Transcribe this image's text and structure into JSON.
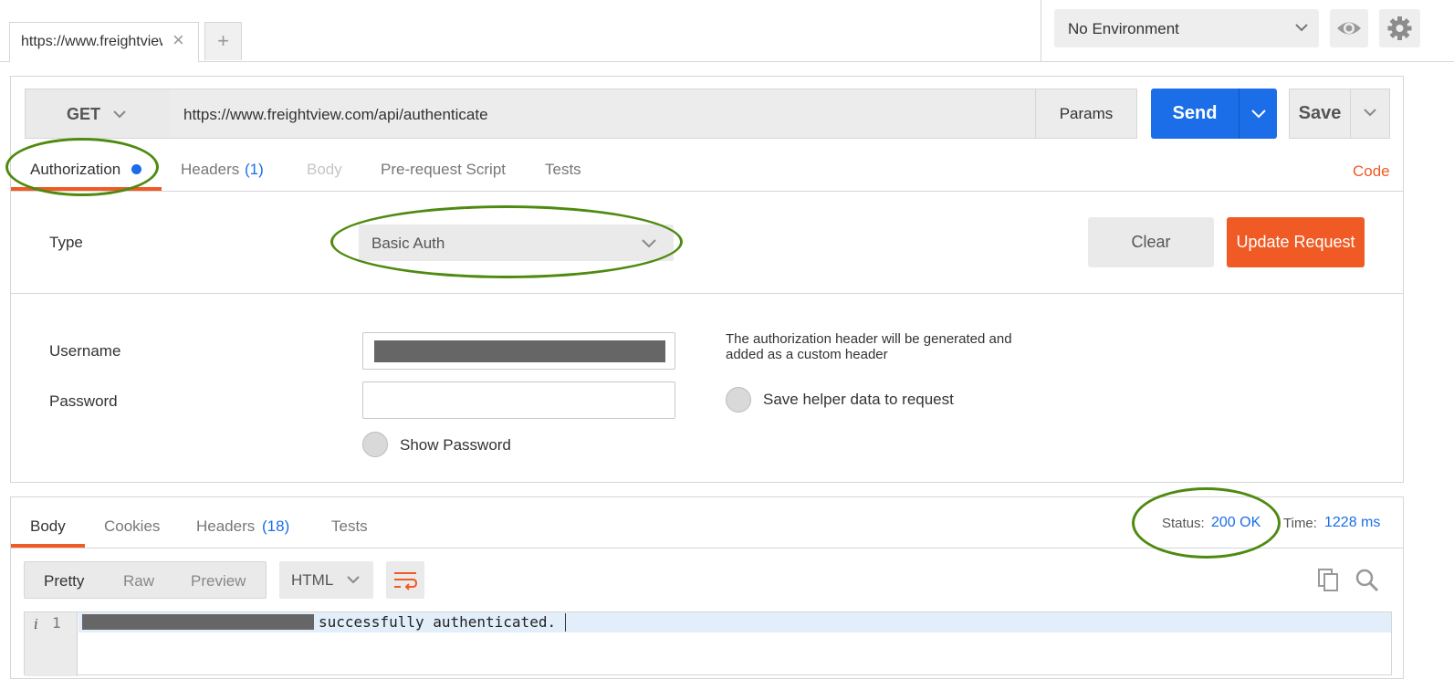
{
  "top_bar": {
    "tab_title": "https://www.freightview.com/api/authenticate",
    "tab_close_icon": "×",
    "new_tab_icon": "+",
    "environment": "No Environment",
    "icons": [
      "close-icon",
      "plus-icon",
      "chevron-down-icon",
      "eye-icon",
      "gear-icon"
    ]
  },
  "request": {
    "method": "GET",
    "url": "https://www.freightview.com/api/authenticate",
    "params_label": "Params",
    "send_label": "Send",
    "save_label": "Save",
    "tabs": {
      "authorization": "Authorization",
      "headers": "Headers",
      "headers_count": "(1)",
      "body": "Body",
      "prerequest": "Pre-request Script",
      "tests": "Tests"
    },
    "code_link": "Code"
  },
  "auth": {
    "type_label": "Type",
    "type_value": "Basic Auth",
    "clear_label": "Clear",
    "update_label": "Update Request",
    "username_label": "Username",
    "password_label": "Password",
    "show_password_label": "Show Password",
    "note": "The authorization header will be generated and added as a custom header",
    "save_helper_label": "Save helper data to request"
  },
  "response": {
    "tabs": {
      "body": "Body",
      "cookies": "Cookies",
      "headers": "Headers",
      "headers_count": "(18)",
      "tests": "Tests"
    },
    "status_label": "Status:",
    "status_value": "200 OK",
    "time_label": "Time:",
    "time_value": "1228 ms",
    "view_modes": {
      "pretty": "Pretty",
      "raw": "Raw",
      "preview": "Preview"
    },
    "format": "HTML",
    "editor": {
      "gutter_info": "i",
      "line_number": "1",
      "line_text": "successfully authenticated."
    }
  },
  "colors": {
    "accent_orange": "#f05a24",
    "send_blue": "#1b6ee8",
    "annotation_green": "#4e8a10"
  }
}
